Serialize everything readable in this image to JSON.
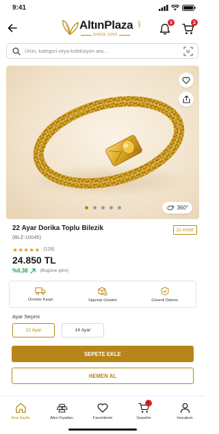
{
  "status": {
    "time": "9:41"
  },
  "header": {
    "logo_text": "AltınPlaza",
    "logo_com": ".com",
    "logo_since": "SINCE 2000",
    "notifications_count": "3",
    "cart_count": "2"
  },
  "search": {
    "placeholder": "Ürün, kategori veya koleksiyon ara..."
  },
  "gallery": {
    "image_count": 5,
    "active_index": 0,
    "view_360_label": "360°"
  },
  "product": {
    "title": "22 Ayar Dorika Toplu Bilezik",
    "karat_badge": "22 AYAR",
    "sku": "(BLZ-10045)",
    "rating": 5,
    "rating_count": "(128)",
    "price": "24.850 TL",
    "change": "%0,38",
    "change_note": "(Bugüne göre)",
    "colors": {
      "accent": "#b8860b",
      "gold_button": "#b6861a",
      "positive": "#1f9a4c",
      "badge": "#d9262c"
    }
  },
  "features": [
    {
      "icon": "truck-icon",
      "label": "Ücretsiz Kargo"
    },
    {
      "icon": "insured-box-icon",
      "label": "Sigortalı Gönderi"
    },
    {
      "icon": "shield-check-icon",
      "label": "Güvenli Ödeme"
    }
  ],
  "ayar": {
    "label": "Ayar Seçimi",
    "options": [
      {
        "label": "22 Ayar",
        "selected": true
      },
      {
        "label": "14 Ayar",
        "selected": false
      }
    ]
  },
  "actions": {
    "add_to_cart": "SEPETE EKLE",
    "buy_now": "HEMEN AL"
  },
  "nav": {
    "items": [
      {
        "label": "Ana Sayfa",
        "icon": "home-icon",
        "active": true
      },
      {
        "label": "Altın Fiyatları",
        "icon": "gold-bars-icon",
        "active": false
      },
      {
        "label": "Favorilerim",
        "icon": "heart-icon",
        "active": false
      },
      {
        "label": "Sepetim",
        "icon": "cart-icon",
        "active": false,
        "badge": "2"
      },
      {
        "label": "Hesabım",
        "icon": "user-icon",
        "active": false
      }
    ]
  }
}
